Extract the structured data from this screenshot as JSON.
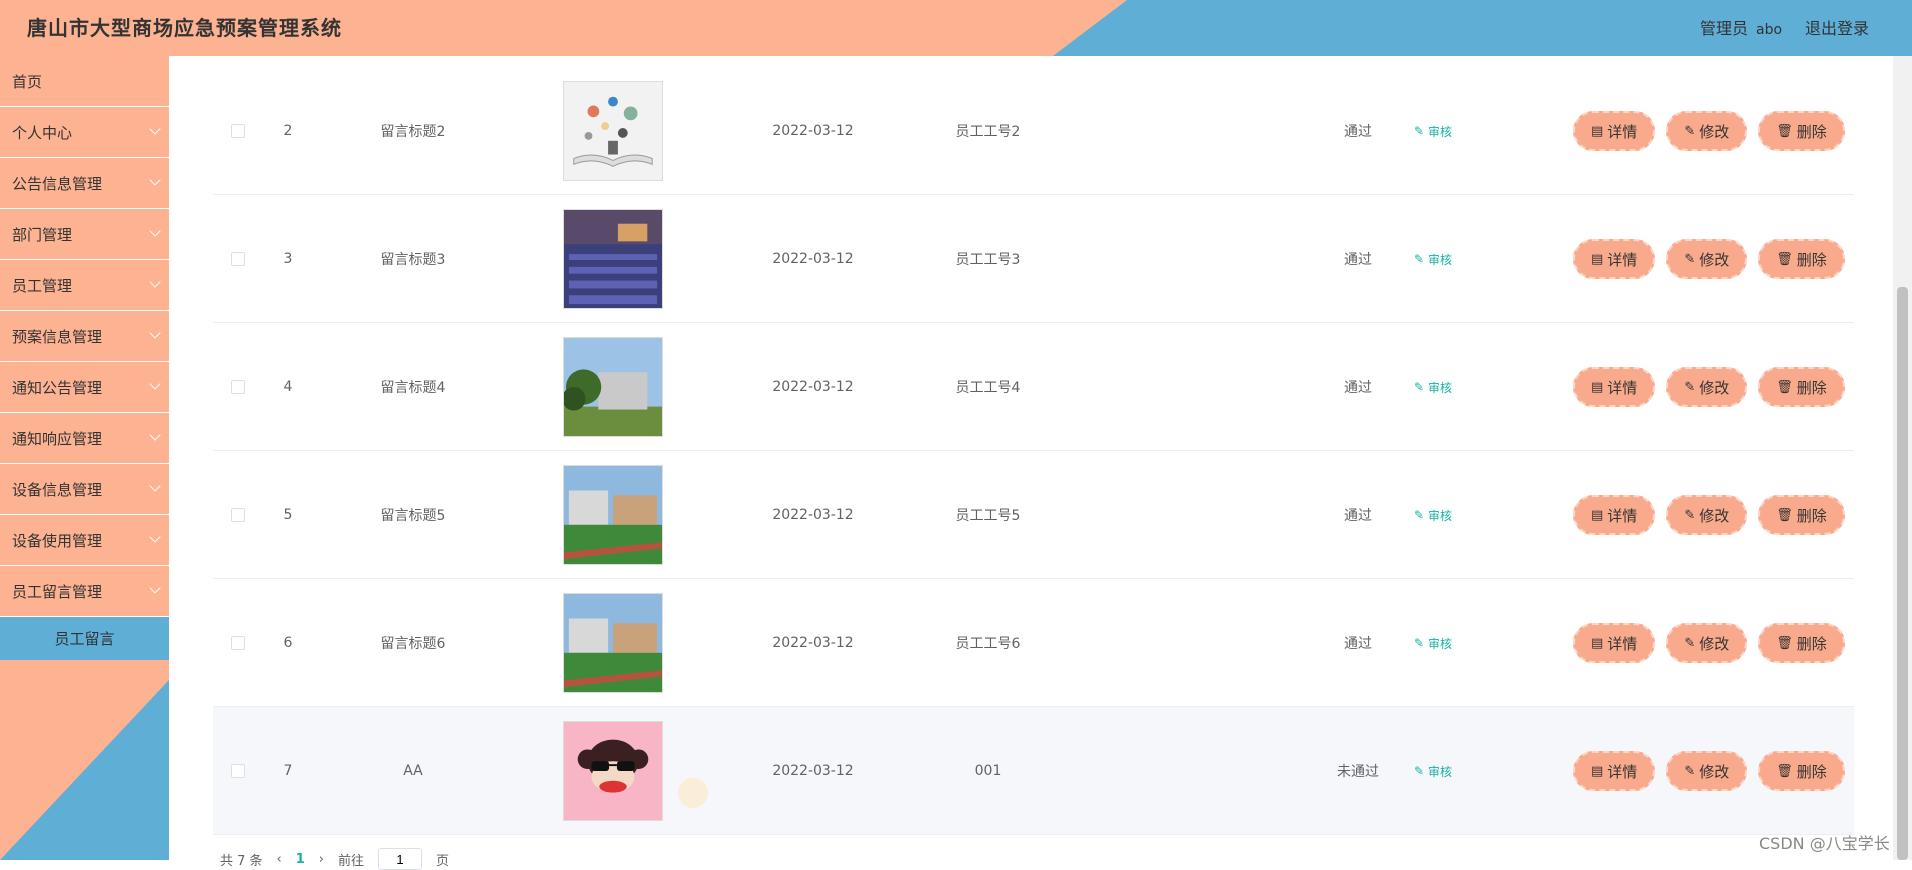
{
  "header": {
    "title": "唐山市大型商场应急预案管理系统",
    "user_role": "管理员",
    "user_name": "abo",
    "logout_label": "退出登录"
  },
  "sidebar": {
    "items": [
      {
        "label": "首页",
        "expandable": false
      },
      {
        "label": "个人中心",
        "expandable": true
      },
      {
        "label": "公告信息管理",
        "expandable": true
      },
      {
        "label": "部门管理",
        "expandable": true
      },
      {
        "label": "员工管理",
        "expandable": true
      },
      {
        "label": "预案信息管理",
        "expandable": true
      },
      {
        "label": "通知公告管理",
        "expandable": true
      },
      {
        "label": "通知响应管理",
        "expandable": true
      },
      {
        "label": "设备信息管理",
        "expandable": true
      },
      {
        "label": "设备使用管理",
        "expandable": true
      },
      {
        "label": "员工留言管理",
        "expandable": true
      }
    ],
    "active_sub": "员工留言"
  },
  "table": {
    "rows": [
      {
        "index": "2",
        "title": "留言标题2",
        "date": "2022-03-12",
        "employee": "员工工号2",
        "status": "通过",
        "image": "book-photo"
      },
      {
        "index": "3",
        "title": "留言标题3",
        "date": "2022-03-12",
        "employee": "员工工号3",
        "status": "通过",
        "image": "auditorium-photo"
      },
      {
        "index": "4",
        "title": "留言标题4",
        "date": "2022-03-12",
        "employee": "员工工号4",
        "status": "通过",
        "image": "campus-building-photo"
      },
      {
        "index": "5",
        "title": "留言标题5",
        "date": "2022-03-12",
        "employee": "员工工号5",
        "status": "通过",
        "image": "sports-field-photo"
      },
      {
        "index": "6",
        "title": "留言标题6",
        "date": "2022-03-12",
        "employee": "员工工号6",
        "status": "通过",
        "image": "sports-field-photo"
      },
      {
        "index": "7",
        "title": "AA",
        "date": "2022-03-12",
        "employee": "001",
        "status": "未通过",
        "image": "monkey-avatar"
      }
    ],
    "audit_label": "审核",
    "detail_label": "详情",
    "edit_label": "修改",
    "delete_label": "删除"
  },
  "pagination": {
    "total_text": "共 7 条",
    "current_page": "1",
    "goto_label": "前往",
    "goto_value": "1",
    "page_suffix": "页"
  },
  "watermark": "CSDN @八宝学长"
}
